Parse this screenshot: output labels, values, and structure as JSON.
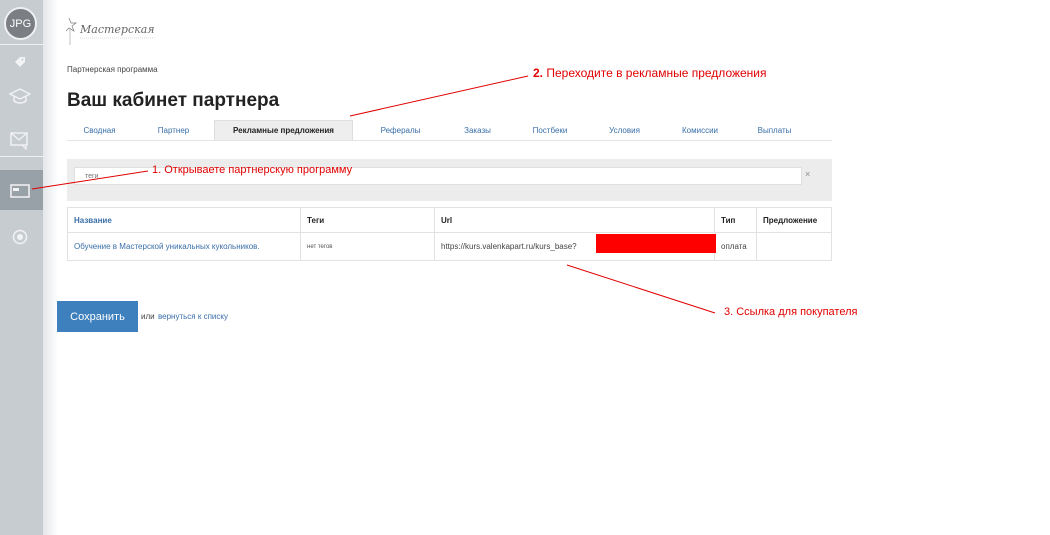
{
  "sidebar": {
    "avatar_text": "JPG",
    "icons": [
      "tag-icon",
      "graduation-cap-icon",
      "message-icon",
      "card-icon",
      "settings-dial-icon"
    ]
  },
  "logo": {
    "text": "Мастерская"
  },
  "breadcrumb": "Партнерская программа",
  "page_title": "Ваш кабинет партнера",
  "tabs": [
    {
      "label": "Сводная"
    },
    {
      "label": "Партнер"
    },
    {
      "label": "Рекламные предложения",
      "active": true
    },
    {
      "label": "Рефералы"
    },
    {
      "label": "Заказы"
    },
    {
      "label": "Постбеки"
    },
    {
      "label": "Условия"
    },
    {
      "label": "Комиссии"
    },
    {
      "label": "Выплаты"
    }
  ],
  "search": {
    "placeholder": "теги",
    "clear_label": "×"
  },
  "table": {
    "headers": [
      "Название",
      "Теги",
      "Url",
      "Тип",
      "Предложение"
    ],
    "rows": [
      {
        "name": "Обучение в Мастерской уникальных кукольников.",
        "tags": "нет тегов",
        "url": "https://kurs.valenkapart.ru/kurs_base?",
        "type": "оплата",
        "offer": ""
      }
    ]
  },
  "actions": {
    "save_label": "Сохранить",
    "or_text": "или",
    "back_link": "вернуться к списку"
  },
  "annotations": {
    "step1": "1. Открываете партнерскую программу",
    "step2_num": "2.",
    "step2_text": "Переходите в рекламные предложения",
    "step3": "3. Ссылка для покупателя"
  },
  "colors": {
    "accent": "#3e7fbd",
    "link": "#3a6fa8",
    "annotation": "#e00000",
    "redaction": "#ff0000",
    "rail": "#c7ccd1"
  }
}
